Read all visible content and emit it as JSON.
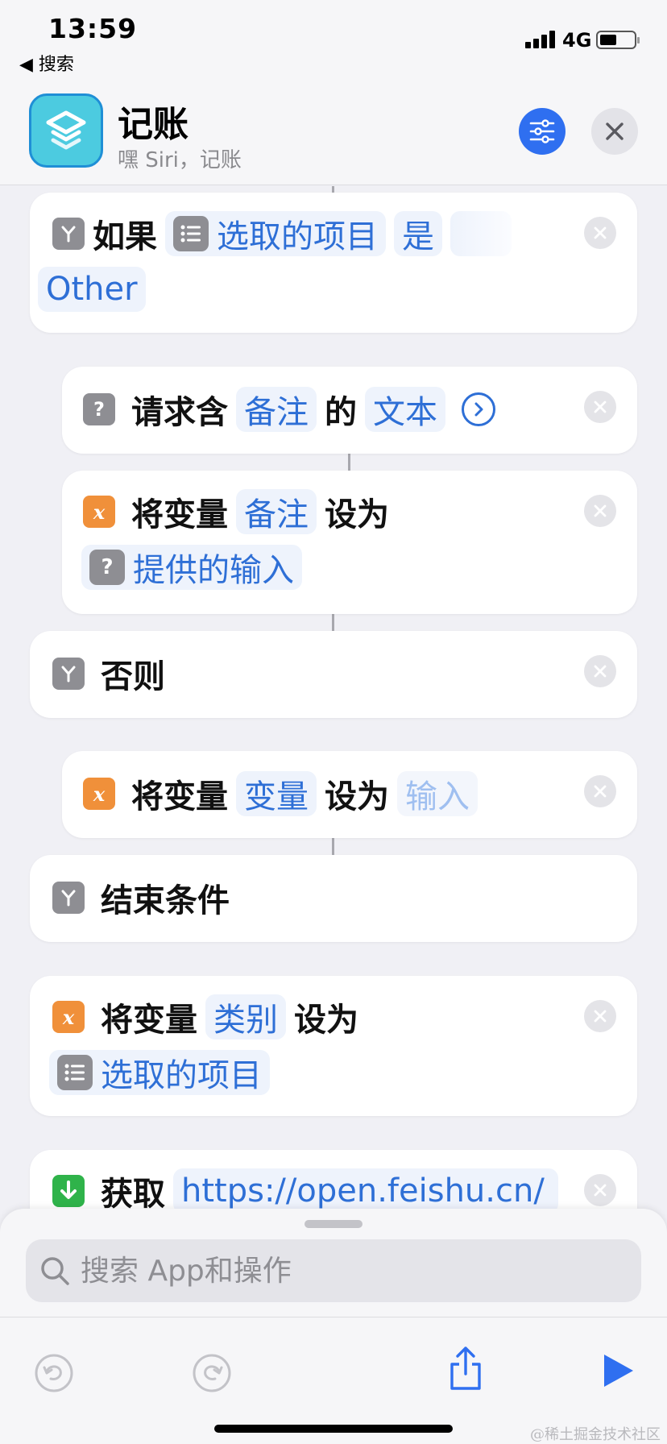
{
  "status_bar": {
    "time": "13:59",
    "back_label": "◀ 搜索",
    "network": "4G"
  },
  "header": {
    "title": "记账",
    "subtitle": "嘿 Siri，记账"
  },
  "actions": {
    "if_block": {
      "keyword": "如果",
      "variable": "选取的项目",
      "operator": "是",
      "value": "Other"
    },
    "ask": {
      "prefix": "请求含",
      "variable": "备注",
      "middle": "的",
      "type": "文本"
    },
    "set_note": {
      "prefix": "将变量",
      "variable": "备注",
      "suffix": "设为",
      "value": "提供的输入"
    },
    "otherwise": {
      "label": "否则"
    },
    "set_var": {
      "prefix": "将变量",
      "variable": "变量",
      "suffix": "设为",
      "value": "输入"
    },
    "end_if": {
      "label": "结束条件"
    },
    "set_category": {
      "prefix": "将变量",
      "variable": "类别",
      "suffix": "设为",
      "value": "选取的项目"
    },
    "get_url": {
      "prefix": "获取",
      "url": "https://open.feishu.cn/"
    }
  },
  "search": {
    "placeholder": "搜索 App和操作"
  },
  "watermark": "@稀土掘金技术社区",
  "colors": {
    "accent": "#2f6ff0",
    "variable_orange": "#f0903a",
    "app_icon": "#4ccbe0"
  }
}
